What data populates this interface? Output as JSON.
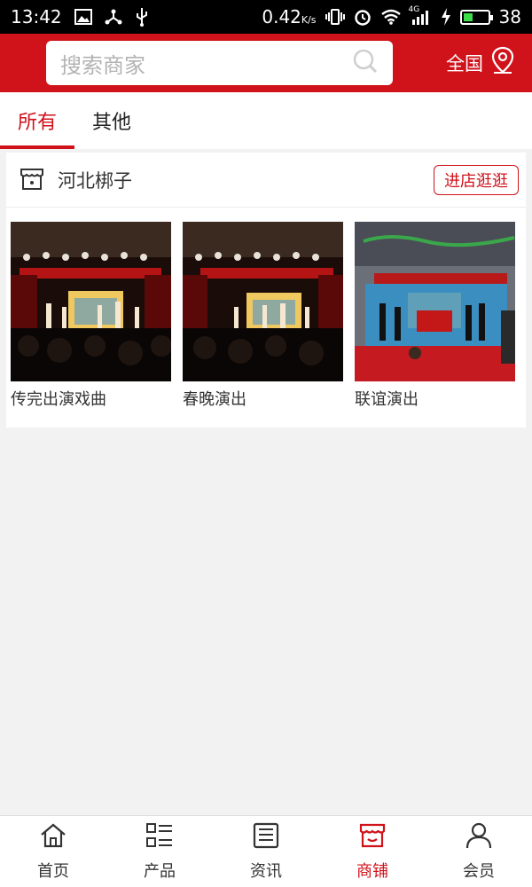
{
  "status_bar": {
    "time": "13:42",
    "network_speed": "0.42",
    "network_unit": "K/s",
    "signal_label": "4G",
    "battery_level": "38",
    "battery_fraction": 0.38,
    "icons": [
      "image-icon",
      "share-icon",
      "usb-icon",
      "vibrate-icon",
      "alarm-icon",
      "wifi-icon",
      "signal-icon",
      "charging-icon",
      "battery-icon"
    ]
  },
  "header": {
    "search_placeholder": "搜索商家",
    "region_label": "全国",
    "brand_color": "#d0121b"
  },
  "tabs": [
    {
      "label": "所有",
      "active": true
    },
    {
      "label": "其他",
      "active": false
    }
  ],
  "shop": {
    "name": "河北梆子",
    "visit_button": "进店逛逛",
    "items": [
      {
        "title": "传完出演戏曲"
      },
      {
        "title": "春晚演出"
      },
      {
        "title": "联谊演出"
      }
    ]
  },
  "bottom_nav": [
    {
      "label": "首页",
      "icon": "home-icon",
      "active": false
    },
    {
      "label": "产品",
      "icon": "grid-list-icon",
      "active": false
    },
    {
      "label": "资讯",
      "icon": "news-icon",
      "active": false
    },
    {
      "label": "商铺",
      "icon": "store-icon",
      "active": true
    },
    {
      "label": "会员",
      "icon": "user-icon",
      "active": false
    }
  ]
}
